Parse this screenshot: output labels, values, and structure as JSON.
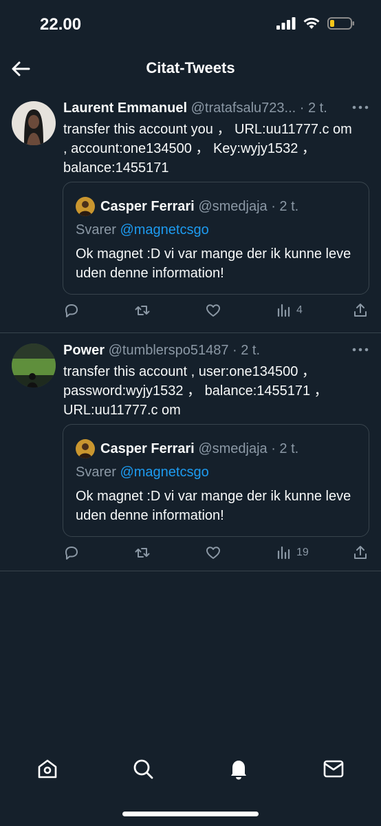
{
  "status": {
    "time": "22.00"
  },
  "header": {
    "title": "Citat-Tweets"
  },
  "tweets": [
    {
      "name": "Laurent Emmanuel",
      "handle": "@tratafsalu723...",
      "time": "· 2 t.",
      "text": "transfer this account you ， URL:uu11777.c om , account:one134500 ， Key:wyjy1532 ， balance:1455171",
      "quote": {
        "name": "Casper Ferrari",
        "handle": "@smedjaja",
        "time": "· 2 t.",
        "reply_prefix": "Svarer",
        "reply_to": "@magnetcsgo",
        "text": "Ok magnet :D vi var mange der ik kunne leve uden denne information!"
      },
      "views": "4"
    },
    {
      "name": "Power",
      "handle": "@tumblerspo51487",
      "time": "· 2 t.",
      "text": "transfer this account , user:one134500 ， password:wyjy1532 ， balance:1455171 ， URL:uu11777.c om",
      "quote": {
        "name": "Casper Ferrari",
        "handle": "@smedjaja",
        "time": "· 2 t.",
        "reply_prefix": "Svarer",
        "reply_to": "@magnetcsgo",
        "text": "Ok magnet :D vi var mange der ik kunne leve uden denne information!"
      },
      "views": "19"
    }
  ],
  "colors": {
    "background": "#15202b",
    "accent": "#1d9bf0",
    "muted": "#8b98a5",
    "border": "#38444d"
  }
}
